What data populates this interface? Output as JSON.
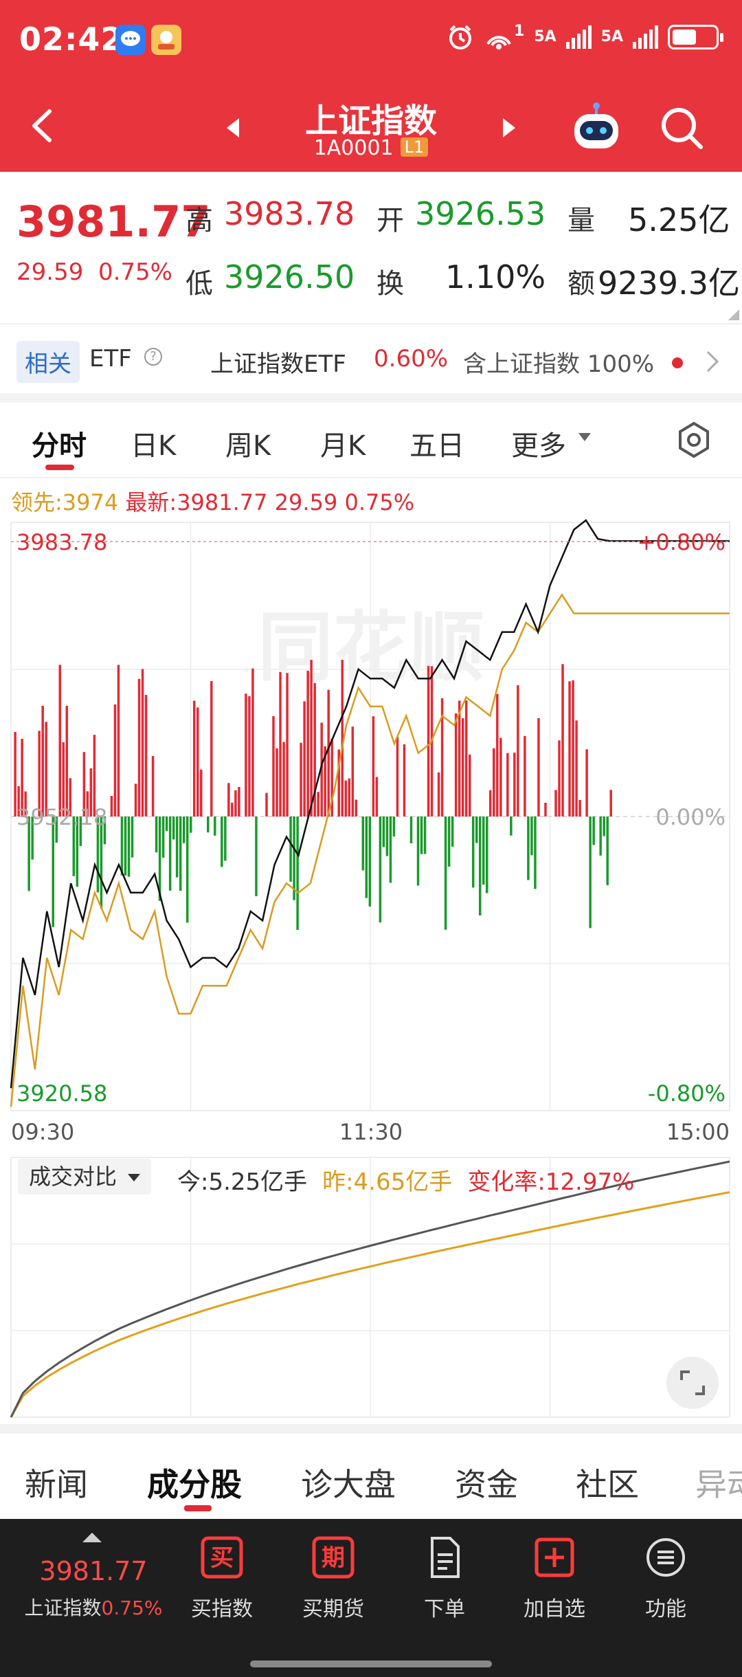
{
  "status_bar": {
    "time": "02:42",
    "network_1": "5A",
    "network_2": "5A",
    "wifi_sub": "1",
    "battery_level": 0.55
  },
  "header": {
    "title": "上证指数",
    "code": "1A0001",
    "badge": "L1"
  },
  "quote": {
    "last": "3981.77",
    "change": "29.59",
    "change_pct": "0.75%",
    "high_label": "高",
    "high": "3983.78",
    "open_label": "开",
    "open": "3926.53",
    "volume_label": "量",
    "volume": "5.25亿",
    "low_label": "低",
    "low": "3926.50",
    "turnover_label": "换",
    "turnover": "1.10%",
    "amount_label": "额",
    "amount": "9239.3亿"
  },
  "etf_row": {
    "tag": "相关",
    "label": "ETF",
    "info": "?",
    "name": "上证指数ETF",
    "change": "0.60%",
    "holding": "含上证指数 100%"
  },
  "period_tabs": [
    "分时",
    "日K",
    "周K",
    "月K",
    "五日",
    "更多"
  ],
  "active_period": 0,
  "intraday_header": {
    "lead": "领先:3974",
    "latest": "最新:3981.77 29.59 0.75%"
  },
  "chart_data": [
    {
      "type": "line",
      "title": "",
      "x": [
        "09:30",
        "11:30",
        "15:00"
      ],
      "y_labels": {
        "top_left": "3983.78",
        "middle_left": "3952.18",
        "bottom_left": "3920.58",
        "top_right": "+0.80%",
        "middle_right": "0.00%",
        "bottom_right": "-0.80%"
      },
      "ylim": [
        3920.58,
        3983.78
      ],
      "prev_close": 3952.18,
      "watermark": "同花顺",
      "series": [
        {
          "name": "最新",
          "color": "#111111",
          "x": [
            0,
            4,
            8,
            12,
            16,
            20,
            24,
            28,
            32,
            36,
            40,
            44,
            48,
            52,
            56,
            60,
            64,
            68,
            72,
            76,
            80,
            84,
            88,
            92,
            96,
            100,
            104,
            108,
            112,
            116,
            120,
            124,
            128,
            132,
            136,
            140,
            144,
            148,
            152,
            156,
            160,
            164,
            168,
            172,
            176,
            180,
            184,
            188,
            192,
            196,
            200,
            204,
            208,
            212,
            216,
            220,
            224,
            228,
            232,
            236,
            240
          ],
          "values": [
            3923,
            3937,
            3933,
            3942,
            3936,
            3945,
            3941,
            3947,
            3944,
            3947,
            3944,
            3944,
            3946,
            3941,
            3939,
            3936,
            3937,
            3937,
            3936,
            3938,
            3942,
            3941,
            3947,
            3950,
            3948,
            3953,
            3958,
            3961,
            3964,
            3968,
            3967,
            3967,
            3966,
            3969,
            3967,
            3967,
            3969,
            3967,
            3971,
            3970,
            3969,
            3972,
            3972,
            3975,
            3972,
            3977,
            3980,
            3983,
            3984,
            3982,
            3981.77,
            3981.77,
            3981.77,
            3981.77,
            3981.77,
            3981.77,
            3981.77,
            3981.77,
            3981.77,
            3981.77,
            3981.77
          ]
        },
        {
          "name": "领先",
          "color": "#d99c1e",
          "x": [
            0,
            4,
            8,
            12,
            16,
            20,
            24,
            28,
            32,
            36,
            40,
            44,
            48,
            52,
            56,
            60,
            64,
            68,
            72,
            76,
            80,
            84,
            88,
            92,
            96,
            100,
            104,
            108,
            112,
            116,
            120,
            124,
            128,
            132,
            136,
            140,
            144,
            148,
            152,
            156,
            160,
            164,
            168,
            172,
            176,
            180,
            184,
            188,
            192,
            196,
            200,
            204,
            208,
            212,
            216,
            220,
            224,
            228,
            232,
            236,
            240
          ],
          "values": [
            3921,
            3934,
            3925,
            3937,
            3933,
            3940,
            3939,
            3944,
            3941,
            3945,
            3940,
            3939,
            3942,
            3935,
            3931,
            3931,
            3934,
            3934,
            3934,
            3937,
            3940,
            3938,
            3943,
            3945,
            3944,
            3945,
            3950,
            3955,
            3962,
            3966,
            3964,
            3964,
            3960,
            3963,
            3959,
            3960,
            3963,
            3962,
            3965,
            3964,
            3963,
            3968,
            3970,
            3973,
            3972,
            3974,
            3976,
            3974,
            3974,
            3974,
            3974,
            3974,
            3974,
            3974,
            3974,
            3974,
            3974,
            3974,
            3974,
            3974,
            3974
          ]
        }
      ],
      "volume_bars_note": "red bars above midline when price rises, green bars below when price falls"
    },
    {
      "type": "line",
      "title": "",
      "x": [
        "09:30",
        "11:30",
        "15:00"
      ],
      "series": [
        {
          "name": "今",
          "color": "#555555",
          "values": [
            0,
            0.3,
            0.44,
            0.55,
            0.65,
            0.76,
            0.9,
            1.0
          ]
        },
        {
          "name": "昨",
          "color": "#e3a01a",
          "values": [
            0,
            0.24,
            0.38,
            0.48,
            0.57,
            0.66,
            0.77,
            0.88
          ]
        }
      ]
    }
  ],
  "volume_compare": {
    "tag": "成交对比",
    "today": "今:5.25亿手",
    "yesterday": "昨:4.65亿手",
    "change_rate": "变化率:12.97%"
  },
  "section_tabs": [
    "新闻",
    "成分股",
    "诊大盘",
    "资金",
    "社区",
    "异动"
  ],
  "active_section": 1,
  "bottom_bar": {
    "price": "3981.77",
    "name": "上证指数",
    "pct": "0.75%",
    "buy_index_icon": "买",
    "buy_index": "买指数",
    "buy_futures_icon": "期",
    "buy_futures": "买期货",
    "order": "下单",
    "add_watch": "加自选",
    "functions": "功能"
  },
  "colors": {
    "header_red": "#e8343d",
    "up": "#e02b35",
    "down": "#1a9a2c",
    "lead_line": "#d99c1e"
  }
}
